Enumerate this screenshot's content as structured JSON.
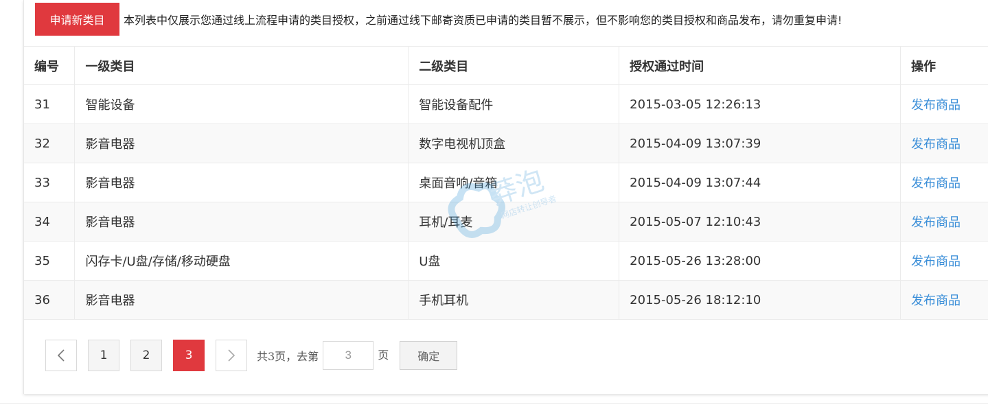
{
  "topbar": {
    "apply_button": "申请新类目",
    "notice": "本列表中仅展示您通过线上流程申请的类目授权，之前通过线下邮寄资质已申请的类目暂不展示，但不影响您的类目授权和商品发布，请勿重复申请!"
  },
  "table": {
    "headers": [
      "编号",
      "一级类目",
      "二级类目",
      "授权通过时间",
      "操作"
    ],
    "rows": [
      {
        "id": "31",
        "level1": "智能设备",
        "level2": "智能设备配件",
        "time": "2015-03-05 12:26:13",
        "action": "发布商品"
      },
      {
        "id": "32",
        "level1": "影音电器",
        "level2": "数字电视机顶盒",
        "time": "2015-04-09 13:07:39",
        "action": "发布商品"
      },
      {
        "id": "33",
        "level1": "影音电器",
        "level2": "桌面音响/音箱",
        "time": "2015-04-09 13:07:44",
        "action": "发布商品"
      },
      {
        "id": "34",
        "level1": "影音电器",
        "level2": "耳机/耳麦",
        "time": "2015-05-07 12:10:43",
        "action": "发布商品"
      },
      {
        "id": "35",
        "level1": "闪存卡/U盘/存储/移动硬盘",
        "level2": "U盘",
        "time": "2015-05-26 13:28:00",
        "action": "发布商品"
      },
      {
        "id": "36",
        "level1": "影音电器",
        "level2": "手机耳机",
        "time": "2015-05-26 18:12:10",
        "action": "发布商品"
      }
    ]
  },
  "pagination": {
    "pages": [
      "1",
      "2",
      "3"
    ],
    "current": "3",
    "total_text": "共3页，去第",
    "goto_value": "3",
    "unit": "页",
    "confirm": "确定",
    "prev_icon": "chevron-left-icon",
    "next_icon": "chevron-right-icon"
  },
  "watermark": {
    "title": "莽泡",
    "subtitle": "网店转让创导者"
  },
  "colors": {
    "accent": "#e0393e",
    "link": "#3a8ed8"
  }
}
